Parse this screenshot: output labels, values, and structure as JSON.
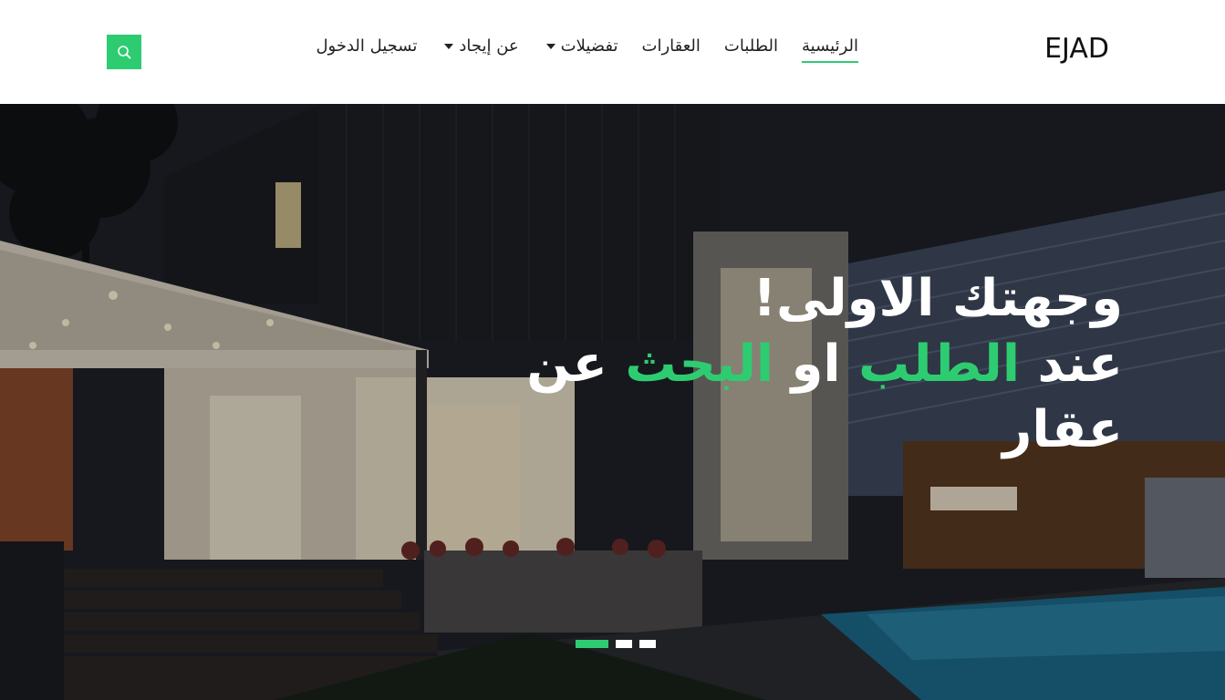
{
  "brand": {
    "logo": "EJAD"
  },
  "nav": {
    "items": [
      {
        "label": "الرئيسية",
        "active": true,
        "dropdown": false
      },
      {
        "label": "الطلبات",
        "active": false,
        "dropdown": false
      },
      {
        "label": "العقارات",
        "active": false,
        "dropdown": false
      },
      {
        "label": "تفضيلات",
        "active": false,
        "dropdown": true
      },
      {
        "label": "عن إيجاد",
        "active": false,
        "dropdown": true
      },
      {
        "label": "تسجيل الدخول",
        "active": false,
        "dropdown": false
      }
    ]
  },
  "search": {
    "icon": "search-icon"
  },
  "hero": {
    "line1": "وجهتك الاولى!",
    "line2_a": "عند",
    "line2_b": "الطلب",
    "line2_c": "او",
    "line2_d": "البحث",
    "line2_e": "عن",
    "line3": "عقار",
    "slides": 3,
    "active_slide": 0
  },
  "colors": {
    "accent": "#2ecc71",
    "header_bg": "#ffffff",
    "text": "#222222"
  }
}
